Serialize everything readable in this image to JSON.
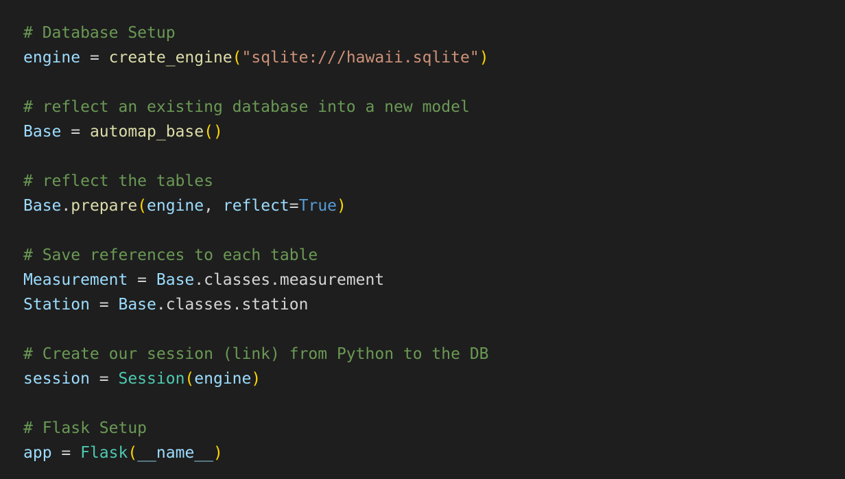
{
  "colors": {
    "background": "#1e1e1e",
    "comment": "#6a9955",
    "variable": "#9cdcfe",
    "function": "#dcdcaa",
    "class": "#4ec9b0",
    "string": "#ce9178",
    "keyword": "#569cd6",
    "operator": "#d4d4d4",
    "bracket": "#ffd700"
  },
  "code": {
    "lines": [
      [
        {
          "t": "comment",
          "v": "# Database Setup"
        }
      ],
      [
        {
          "t": "var",
          "v": "engine"
        },
        {
          "t": "op",
          "v": " = "
        },
        {
          "t": "fn",
          "v": "create_engine"
        },
        {
          "t": "paren",
          "v": "("
        },
        {
          "t": "string",
          "v": "\"sqlite:///hawaii.sqlite\""
        },
        {
          "t": "paren",
          "v": ")"
        }
      ],
      [],
      [
        {
          "t": "comment",
          "v": "# reflect an existing database into a new model"
        }
      ],
      [
        {
          "t": "var",
          "v": "Base"
        },
        {
          "t": "op",
          "v": " = "
        },
        {
          "t": "fn",
          "v": "automap_base"
        },
        {
          "t": "paren",
          "v": "()"
        }
      ],
      [],
      [
        {
          "t": "comment",
          "v": "# reflect the tables"
        }
      ],
      [
        {
          "t": "var",
          "v": "Base"
        },
        {
          "t": "plain",
          "v": "."
        },
        {
          "t": "fn",
          "v": "prepare"
        },
        {
          "t": "paren",
          "v": "("
        },
        {
          "t": "var",
          "v": "engine"
        },
        {
          "t": "plain",
          "v": ", "
        },
        {
          "t": "var",
          "v": "reflect"
        },
        {
          "t": "op",
          "v": "="
        },
        {
          "t": "keyword",
          "v": "True"
        },
        {
          "t": "paren",
          "v": ")"
        }
      ],
      [],
      [
        {
          "t": "comment",
          "v": "# Save references to each table"
        }
      ],
      [
        {
          "t": "var",
          "v": "Measurement"
        },
        {
          "t": "op",
          "v": " = "
        },
        {
          "t": "var",
          "v": "Base"
        },
        {
          "t": "plain",
          "v": ".classes.measurement"
        }
      ],
      [
        {
          "t": "var",
          "v": "Station"
        },
        {
          "t": "op",
          "v": " = "
        },
        {
          "t": "var",
          "v": "Base"
        },
        {
          "t": "plain",
          "v": ".classes.station"
        }
      ],
      [],
      [
        {
          "t": "comment",
          "v": "# Create our session (link) from Python to the DB"
        }
      ],
      [
        {
          "t": "var",
          "v": "session"
        },
        {
          "t": "op",
          "v": " = "
        },
        {
          "t": "class",
          "v": "Session"
        },
        {
          "t": "paren",
          "v": "("
        },
        {
          "t": "var",
          "v": "engine"
        },
        {
          "t": "paren",
          "v": ")"
        }
      ],
      [],
      [
        {
          "t": "comment",
          "v": "# Flask Setup"
        }
      ],
      [
        {
          "t": "var",
          "v": "app"
        },
        {
          "t": "op",
          "v": " = "
        },
        {
          "t": "class",
          "v": "Flask"
        },
        {
          "t": "paren",
          "v": "("
        },
        {
          "t": "var",
          "v": "__name__"
        },
        {
          "t": "paren",
          "v": ")"
        }
      ]
    ]
  }
}
